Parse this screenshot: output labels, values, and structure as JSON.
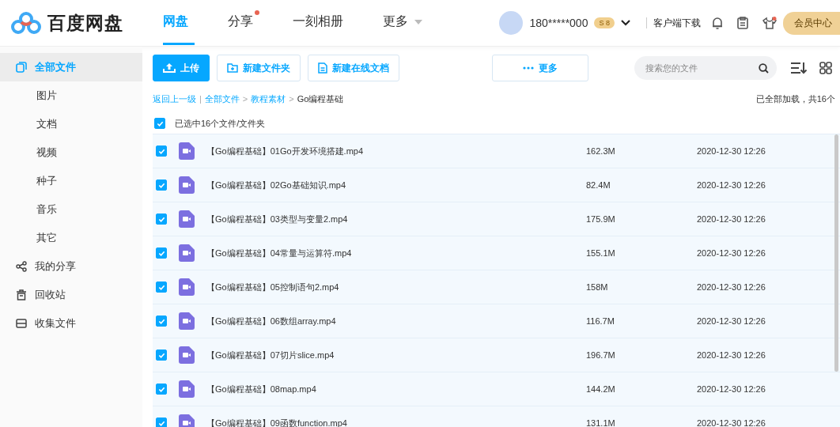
{
  "logo": {
    "text": "百度网盘"
  },
  "nav": [
    {
      "label": "网盘",
      "selected": true,
      "kind": "plain"
    },
    {
      "label": "分享",
      "selected": false,
      "kind": "badge"
    },
    {
      "label": "一刻相册",
      "selected": false,
      "kind": "plain"
    },
    {
      "label": "更多",
      "selected": false,
      "kind": "menu"
    }
  ],
  "user": {
    "name": "180*****000",
    "coin": "S",
    "level": "8"
  },
  "header_actions": {
    "download": "客户端下载",
    "member": "会员中心"
  },
  "sidebar": {
    "items": [
      {
        "label": "全部文件",
        "kind": "main",
        "selected": true
      },
      {
        "label": "图片",
        "kind": "sub",
        "selected": false
      },
      {
        "label": "文档",
        "kind": "sub",
        "selected": false
      },
      {
        "label": "视频",
        "kind": "sub",
        "selected": false
      },
      {
        "label": "种子",
        "kind": "sub",
        "selected": false
      },
      {
        "label": "音乐",
        "kind": "sub",
        "selected": false
      },
      {
        "label": "其它",
        "kind": "sub",
        "selected": false
      },
      {
        "label": "我的分享",
        "kind": "main",
        "selected": false
      },
      {
        "label": "回收站",
        "kind": "main",
        "selected": false
      },
      {
        "label": "收集文件",
        "kind": "main",
        "selected": false
      }
    ]
  },
  "toolbar": {
    "buttons": [
      {
        "label": "上传",
        "kind": "primary"
      },
      {
        "label": "新建文件夹",
        "kind": "plain"
      },
      {
        "label": "新建在线文档",
        "kind": "plain"
      },
      {
        "label": "更多",
        "kind": "more"
      }
    ],
    "search": {
      "placeholder": "搜索您的文件"
    }
  },
  "breadcrumb": {
    "back": "返回上一级",
    "divider": "|",
    "separator": ">",
    "items": [
      "全部文件",
      "教程素材",
      "Go编程基础"
    ],
    "status": "已全部加载，共16个"
  },
  "select_all": {
    "label": "已选中16个文件/文件夹",
    "checked": true
  },
  "files": [
    {
      "name": "【Go编程基础】01Go开发环境搭建.mp4",
      "size": "162.3M",
      "date": "2020-12-30 12:26",
      "checked": true
    },
    {
      "name": "【Go编程基础】02Go基础知识.mp4",
      "size": "82.4M",
      "date": "2020-12-30 12:26",
      "checked": true
    },
    {
      "name": "【Go编程基础】03类型与变量2.mp4",
      "size": "175.9M",
      "date": "2020-12-30 12:26",
      "checked": true
    },
    {
      "name": "【Go编程基础】04常量与运算符.mp4",
      "size": "155.1M",
      "date": "2020-12-30 12:26",
      "checked": true
    },
    {
      "name": "【Go编程基础】05控制语句2.mp4",
      "size": "158M",
      "date": "2020-12-30 12:26",
      "checked": true
    },
    {
      "name": "【Go编程基础】06数组array.mp4",
      "size": "116.7M",
      "date": "2020-12-30 12:26",
      "checked": true
    },
    {
      "name": "【Go编程基础】07切片slice.mp4",
      "size": "196.7M",
      "date": "2020-12-30 12:26",
      "checked": true
    },
    {
      "name": "【Go编程基础】08map.mp4",
      "size": "144.2M",
      "date": "2020-12-30 12:26",
      "checked": true
    },
    {
      "name": "【Go编程基础】09函数function.mp4",
      "size": "131.1M",
      "date": "2020-12-30 12:26",
      "checked": true
    }
  ]
}
